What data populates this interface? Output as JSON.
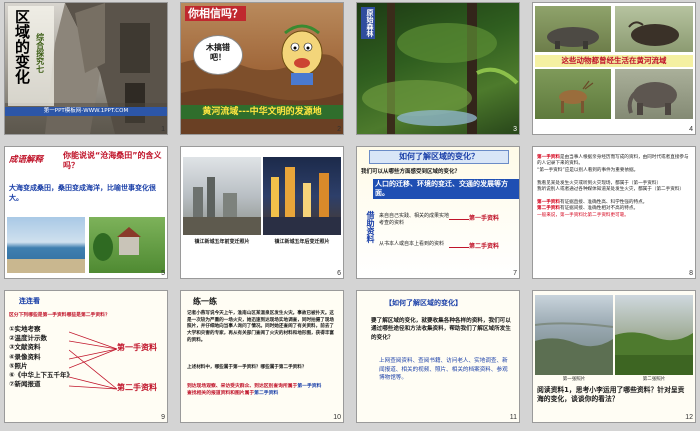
{
  "slides": [
    {
      "num": "1",
      "title_cn": "区域的变化",
      "subtitle": "综合探究七",
      "footer": "第一PPT模板网-WWW.1PPT.COM"
    },
    {
      "num": "2",
      "question": "你相信吗？",
      "bubble": "木搞错吧！",
      "banner": "黄河流域---中华文明的发源地"
    },
    {
      "num": "3",
      "tag": "原始森林"
    },
    {
      "num": "4",
      "caption": "这些动物都曾经生活在黄河流域"
    },
    {
      "num": "5",
      "heading": "成语解释",
      "question": "你能说说“沧海桑田”的含义吗？",
      "answer": "大海变成桑田，桑田变成海洋，比喻世事变化很大。"
    },
    {
      "num": "6",
      "caption_left": "镇江新城五年前变迁照片",
      "caption_right": "镇江新城五年后变迁照片"
    },
    {
      "num": "7",
      "title": "如何了解区域的变化？",
      "q1": "我们可以从哪些方面感受到区域的变化？",
      "a1": "人口的迁移、环境的变迁、交通的发展等方面。",
      "side": "借助资料",
      "line1": "来自自己实践、相关的成果实地考查的资料",
      "label1": "第一手资料",
      "line2": "从书本人或自本上看到的资料",
      "label2": "第二手资料"
    },
    {
      "num": "8",
      "p1_label": "第一手资料",
      "p1": "是由当事人根据亲身经历而写成的资料，由同时代或者直接参与的人记录下来的资料。",
      "p1b": "“第一手资料”应是以别人看到的事件为重要依据。",
      "p2": "我看见某处发生火灾或听到火灾现场，都属于（第一手资料）",
      "p3": "我听说别人或者通过各种媒体知道某处发生火灾，都属于（第二手资料）",
      "p4_label": "第一手资料",
      "p4": "有证据直接、准确性高、科学性强的特点。",
      "p5_label": "第二手资料",
      "p5": "有证据间接、准确性相对不高的特点。",
      "p6": "一般来说，第一手资料比第二手资料更可靠。"
    },
    {
      "num": "9",
      "title": "连连看",
      "question": "区分下列哪些是第一手资料哪些是第二手资料？",
      "items": [
        "①实地考察",
        "②温度计示数",
        "③文献资料",
        "④录像资料",
        "⑤照片",
        "⑥《中华上下五千年》",
        "⑦新闻报道"
      ],
      "label1": "第一手资料",
      "label2": "第二手资料"
    },
    {
      "num": "10",
      "title": "练一练",
      "body": "记者小燕写说今天上午，淮南山区某温泉区发生火灾。事故已被扑灭。这是一次较为严重的一场火灾，她迅速到达现场实地调查，同时拍摄了现场照片，并仔细地向当事人询问了情况。同时她还查阅了有关资料，前去了大学和灾害的专家，再从有关部门查阅了火灾的材料和地形图，获得丰富的资料。",
      "q": "上述材料中，哪些属于第一手资料？哪些属于第二手资料？",
      "a1": "到达现场观察、采访受灾群众、到达区别查询所属于",
      "a1b": "第一手资料",
      "a2": "查找相关的报道资料和图片属于",
      "a2b": "第二手资料"
    },
    {
      "num": "11",
      "title": "【如何了解区域的变化】",
      "para": "要了解区域的变化，就要收集各种各样的资料，我们可以通过哪些途径和方法收集资料，帮助我们了解区域所发生的变化？",
      "methods": "上网查阅资料、查阅书籍、访问老人、实地调查、新闻报道、相关的视频、照片、相关的档案资料、参观博物馆等。"
    },
    {
      "num": "12",
      "caption1": "第一张照片",
      "caption2": "第二张照片",
      "question": "阅读资料1，思考小李运用了哪些资料？针对呈贡海的变化，谈谈你的看法？"
    }
  ]
}
